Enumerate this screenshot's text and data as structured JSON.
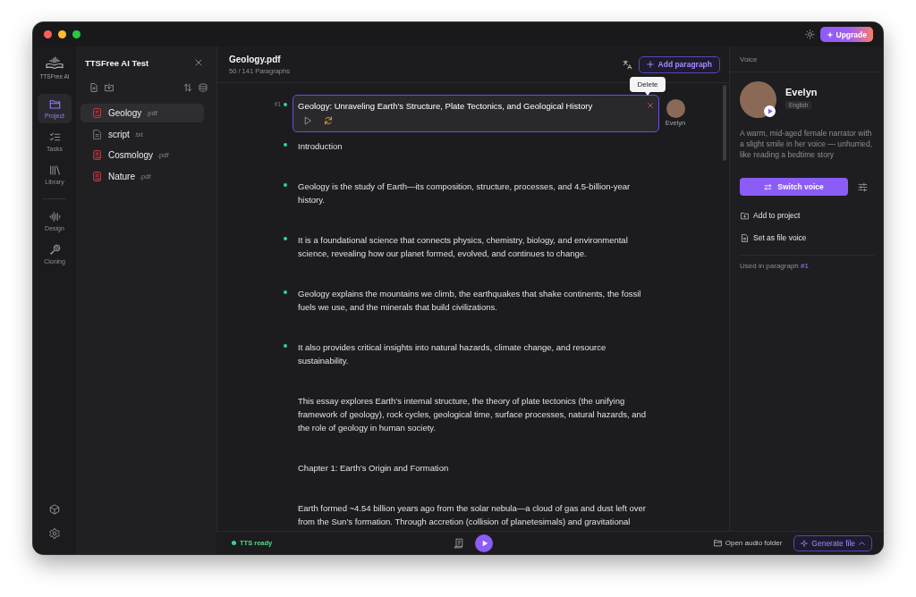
{
  "titlebar": {
    "upgrade_button": "Upgrade"
  },
  "nav": {
    "app_name": "TTSFree AI",
    "items": [
      {
        "label": "Project",
        "selected": true
      },
      {
        "label": "Tasks",
        "selected": false
      },
      {
        "label": "Library",
        "selected": false
      }
    ],
    "tools": [
      {
        "label": "Design",
        "selected": false
      },
      {
        "label": "Cloning",
        "selected": false
      }
    ]
  },
  "file_panel": {
    "title": "TTSFree AI Test",
    "files": [
      {
        "name": "Geology",
        "extension": ".pdf",
        "kind": "pdf",
        "selected": true
      },
      {
        "name": "script",
        "extension": ".txt",
        "kind": "txt",
        "selected": false
      },
      {
        "name": "Cosmology",
        "extension": ".pdf",
        "kind": "pdf",
        "selected": false
      },
      {
        "name": "Nature",
        "extension": ".pdf",
        "kind": "pdf",
        "selected": false
      }
    ]
  },
  "document": {
    "title": "Geology.pdf",
    "paragraph_count": "50 / 141 Paragraphs",
    "add_button": "Add paragraph",
    "tooltip": "Delete",
    "paragraphs": [
      {
        "number": "#1",
        "text": "Geology: Unraveling Earth’s Structure, Plate Tectonics, and Geological History",
        "generated": true,
        "selected": true,
        "voice": "Evelyn"
      },
      {
        "text": "Introduction",
        "generated": true,
        "selected": false
      },
      {
        "text": "Geology is the study of Earth—its composition, structure, processes, and 4.5-billion-year history.",
        "generated": true,
        "selected": false
      },
      {
        "text": "It is a foundational science that connects physics, chemistry, biology, and environmental science, revealing how our planet formed, evolved, and continues to change.",
        "generated": true,
        "selected": false
      },
      {
        "text": "Geology explains the mountains we climb, the earthquakes that shake continents, the fossil fuels we use, and the minerals that build civilizations.",
        "generated": true,
        "selected": false
      },
      {
        "text": "It also provides critical insights into natural hazards, climate change, and resource sustainability.",
        "generated": true,
        "selected": false
      },
      {
        "text": "This essay explores Earth’s internal structure, the theory of plate tectonics (the unifying framework of geology), rock cycles, geological time, surface processes, natural hazards, and the role of geology in human society.",
        "generated": false,
        "selected": false
      },
      {
        "text": "Chapter 1: Earth’s Origin and Formation",
        "generated": false,
        "selected": false
      },
      {
        "text": "Earth formed ~4.54 billion years ago from the solar nebula—a cloud of gas and dust left over from the Sun’s formation. Through accretion (collision of planetesimals) and gravitational",
        "generated": false,
        "selected": false
      }
    ]
  },
  "bottom_bar": {
    "status": "TTS ready",
    "open_folder": "Open audio folder",
    "generate_button": "Generate file"
  },
  "voice_panel": {
    "header": "Voice",
    "name": "Evelyn",
    "language": "English",
    "description": "A warm, mid-aged female narrator with a slight smile in her voice — unhurried, like reading a bedtime story",
    "switch_button": "Switch voice",
    "actions": [
      "Add to project",
      "Set as file voice"
    ],
    "usage_label": "Used in paragraph",
    "usage_link": "#1"
  }
}
